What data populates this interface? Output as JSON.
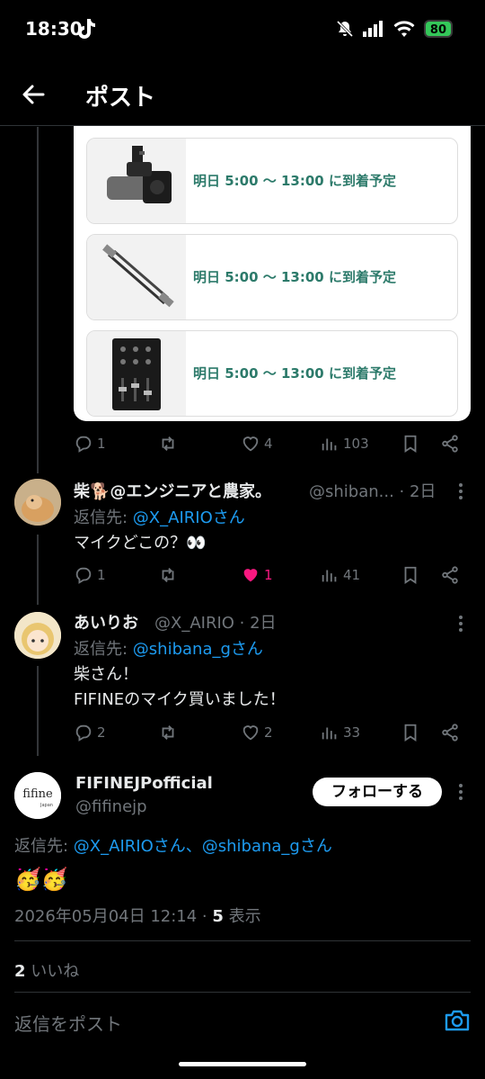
{
  "status_bar": {
    "time": "18:30",
    "battery": "80"
  },
  "header": {
    "title": "ポスト"
  },
  "image_card": {
    "orders": [
      {
        "item": "microphone",
        "eta": "明日 5:00 〜 13:00 に到着予定"
      },
      {
        "item": "xlr-cable",
        "eta": "明日 5:00 〜 13:00 に到着予定"
      },
      {
        "item": "audio-mixer",
        "eta": "明日 5:00 〜 13:00 に到着予定"
      }
    ]
  },
  "post1_actions": {
    "replies": "1",
    "reposts": "",
    "likes": "4",
    "views": "103"
  },
  "post2": {
    "name": "柴🐕@エンジニアと農家。",
    "handle_time": "@shiban... · 2日",
    "reply_prefix": "返信先: ",
    "reply_to": "@X_AIRIOさん",
    "text": "マイクどこの？👀",
    "actions": {
      "replies": "1",
      "reposts": "",
      "likes": "1",
      "views": "41"
    }
  },
  "post3": {
    "name": "あいりお",
    "handle_time": "@X_AIRIO · 2日",
    "reply_prefix": "返信先: ",
    "reply_to": "@shibana_gさん",
    "text_line1": "柴さん！",
    "text_line2": "FIFINEのマイク買いました！",
    "actions": {
      "replies": "2",
      "reposts": "",
      "likes": "2",
      "views": "33"
    }
  },
  "main_post": {
    "name": "FIFINEJPofficial",
    "handle": "@fifinejp",
    "avatar_logo": "fifine",
    "avatar_sub": "Japan",
    "follow_label": "フォローする",
    "reply_prefix": "返信先: ",
    "reply_to": "@X_AIRIOさん、@shibana_gさん",
    "text": "🥳🥳",
    "timestamp": "2026年05月04日 12:14 · ",
    "views_count": "5",
    "views_label": " 表示",
    "likes_count": "2",
    "likes_label": " いいね"
  },
  "reply_box": {
    "placeholder": "返信をポスト"
  },
  "colors": {
    "accent": "#1d9bf0",
    "like": "#f91880",
    "eta_text": "#2c7a6a"
  }
}
